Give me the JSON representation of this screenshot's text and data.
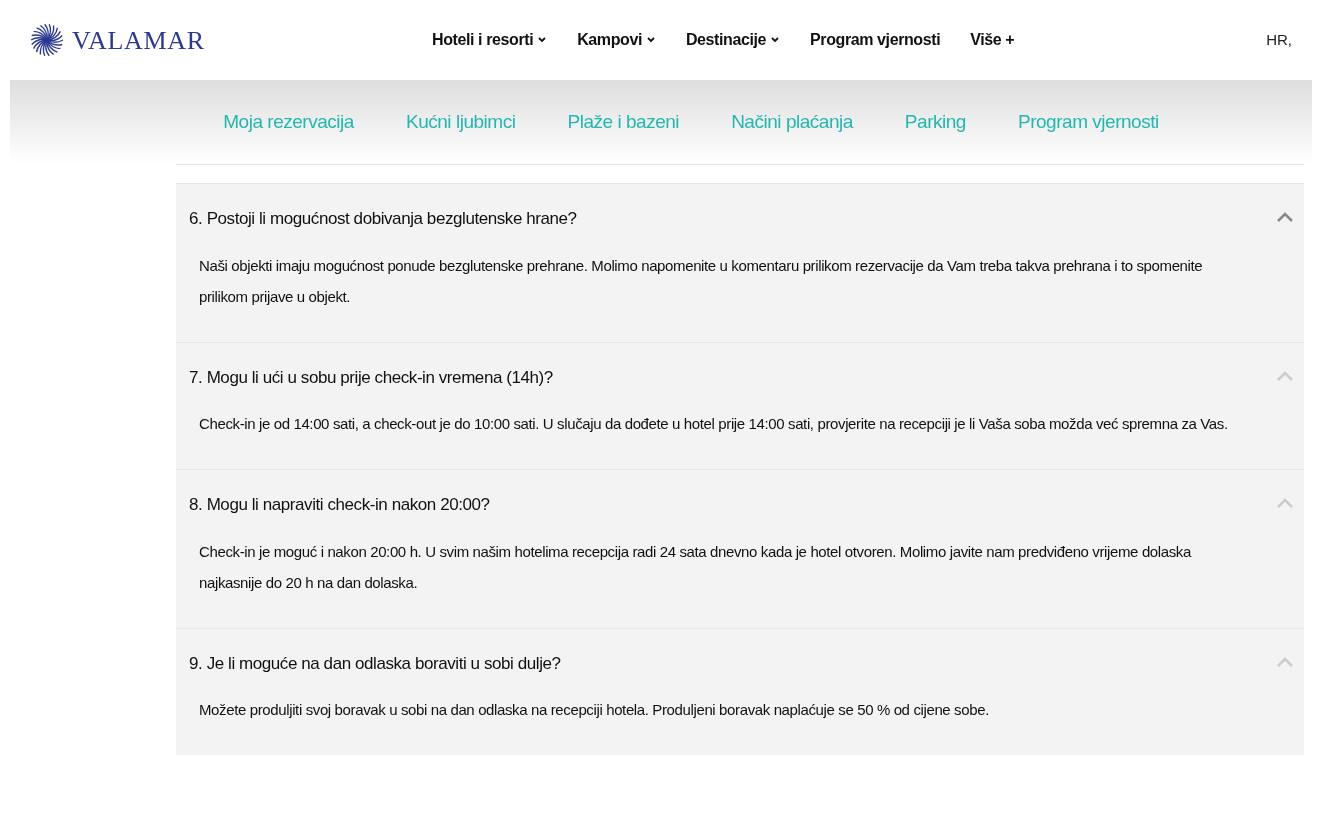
{
  "header": {
    "logo": "VALAMAR",
    "nav": [
      {
        "label": "Hoteli i resorti",
        "kind": "dropdown"
      },
      {
        "label": "Kampovi",
        "kind": "dropdown"
      },
      {
        "label": "Destinacije",
        "kind": "dropdown"
      },
      {
        "label": "Program vjernosti",
        "kind": "link"
      },
      {
        "label": "Više +",
        "kind": "link"
      }
    ],
    "language": "HR,"
  },
  "subnav": [
    "Moja rezervacija",
    "Kućni ljubimci",
    "Plaže i bazeni",
    "Načini plaćanja",
    "Parking",
    "Program vjernosti"
  ],
  "faq": [
    {
      "question": "6. Postoji li mogućnost dobivanja bezglutenske hrane?",
      "answer": "Naši objekti imaju mogućnost ponude bezglutenske prehrane. Molimo napomenite u komentaru prilikom rezervacije da Vam treba takva prehrana i to spomenite prilikom prijave u objekt.",
      "expanded": true,
      "highlighted": true
    },
    {
      "question": "7. Mogu li ući u sobu prije check-in vremena (14h)?",
      "answer": "Check-in je od 14:00 sati, a check-out je do 10:00 sati. U slučaju da dođete u hotel prije 14:00 sati, provjerite na recepciji je li Vaša soba možda već spremna za Vas.",
      "expanded": true,
      "highlighted": false
    },
    {
      "question": "8. Mogu li napraviti check-in nakon 20:00?",
      "answer": "Check-in je moguć i nakon 20:00 h. U svim našim hotelima recepcija radi 24 sata dnevno kada je hotel otvoren. Molimo javite nam predviđeno vrijeme dolaska najkasnije do 20 h na dan dolaska.",
      "expanded": true,
      "highlighted": false
    },
    {
      "question": "9. Je li moguće na dan odlaska boraviti u sobi dulje?",
      "answer": "Možete produljiti svoj boravak u sobi na dan odlaska na recepciji hotela. Produljeni boravak naplaćuje se 50 % od cijene sobe.",
      "expanded": true,
      "highlighted": false
    }
  ]
}
